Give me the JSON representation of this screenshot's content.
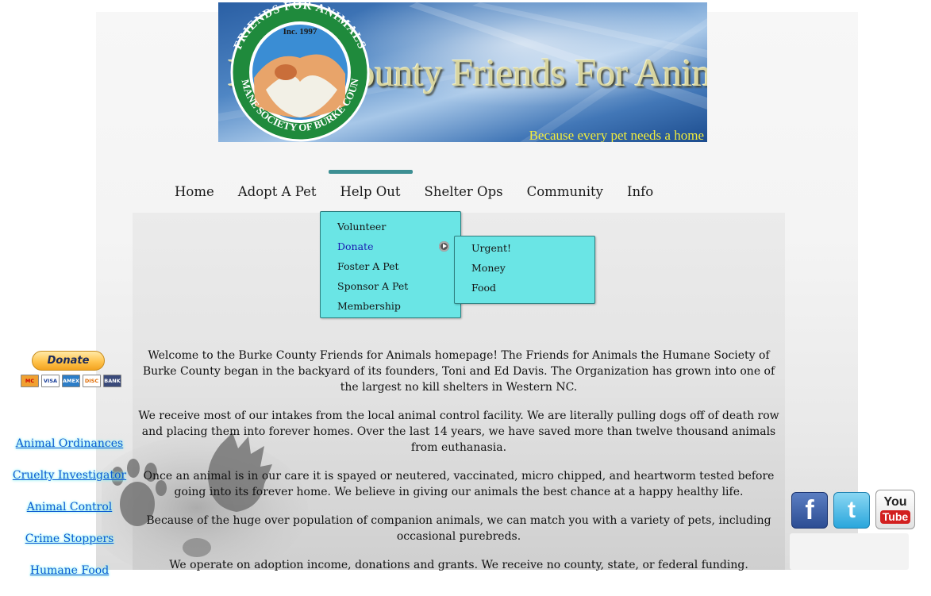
{
  "banner": {
    "title": "Burke County Friends For Animals",
    "tagline": "Because every pet needs a home",
    "seal_top": "FRIENDS FOR ANIMALS",
    "seal_bottom": "HUMANE SOCIETY OF BURKE COUNTY",
    "seal_year": "Inc. 1997"
  },
  "nav": {
    "items": [
      {
        "label": "Home"
      },
      {
        "label": "Adopt A Pet"
      },
      {
        "label": "Help Out"
      },
      {
        "label": "Shelter Ops"
      },
      {
        "label": "Community"
      },
      {
        "label": "Info"
      }
    ],
    "active": "Help Out"
  },
  "dropdown": {
    "items": [
      {
        "label": "Volunteer"
      },
      {
        "label": "Donate"
      },
      {
        "label": "Foster A Pet"
      },
      {
        "label": "Sponsor A Pet"
      },
      {
        "label": "Membership"
      }
    ],
    "submenu": [
      {
        "label": "Urgent!"
      },
      {
        "label": "Money"
      },
      {
        "label": "Food"
      }
    ]
  },
  "content": {
    "paragraphs": [
      "Welcome to the Burke County Friends for Animals homepage! The Friends for Animals the Humane Society of Burke County began in the backyard of its founders, Toni and Ed Davis. The Organization has grown into one of the largest no kill shelters in Western NC.",
      "We receive most of our intakes from the local animal control facility. We are literally pulling dogs off of death row and placing them into forever homes. Over the last 14 years, we have saved more than twelve thousand animals from euthanasia.",
      "Once an animal is in our care it is spayed or neutered, vaccinated, micro chipped, and heartworm tested before going into its forever home. We believe in giving our animals the best chance at a happy healthy life.",
      "Because of the huge over population of companion animals, we can match you with a variety of pets, including occasional purebreds.",
      "We operate on adoption income, donations and grants. We receive no county, state, or federal funding."
    ]
  },
  "sidebar": {
    "donate_label": "Donate",
    "cards": [
      "MC",
      "VISA",
      "AMEX",
      "DISC",
      "BANK"
    ],
    "links": [
      {
        "label": "Animal Ordinances"
      },
      {
        "label": "Cruelty Investigator"
      },
      {
        "label": "Animal Control"
      },
      {
        "label": "Crime Stoppers"
      },
      {
        "label": "Humane Food"
      }
    ]
  },
  "social": {
    "facebook": "f",
    "twitter": "t",
    "youtube_you": "You",
    "youtube_tube": "Tube"
  }
}
